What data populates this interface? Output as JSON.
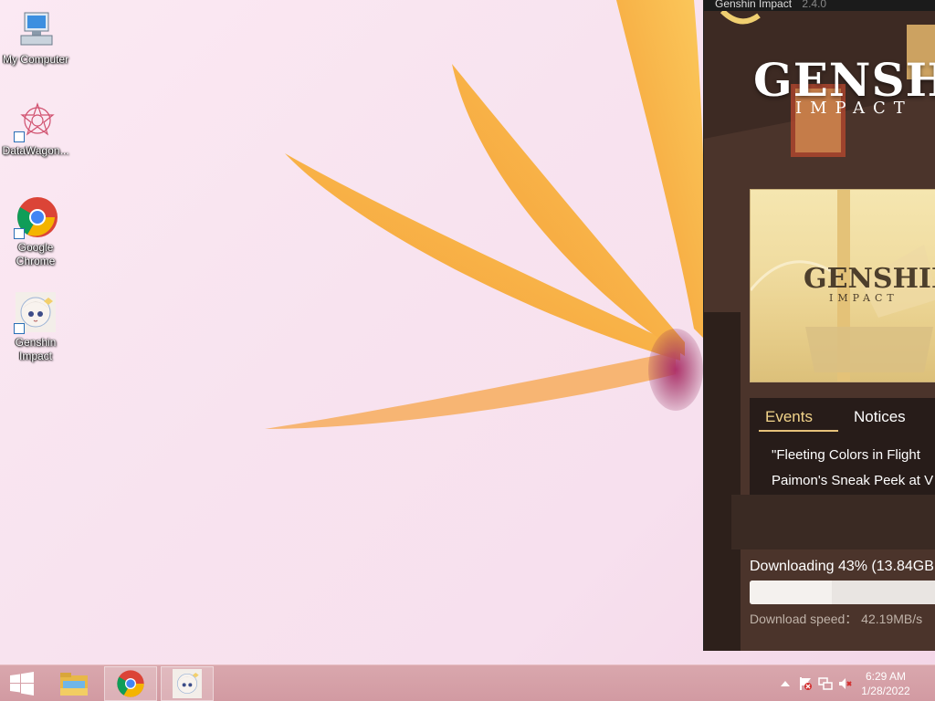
{
  "desktop": {
    "icons": [
      {
        "name": "my-computer",
        "label": "My Computer",
        "icon": "computer-icon"
      },
      {
        "name": "datawagon",
        "label": "DataWagon...",
        "icon": "datawagon-icon"
      },
      {
        "name": "google-chrome",
        "label": "Google Chrome",
        "icon": "chrome-icon"
      },
      {
        "name": "genshin-impact",
        "label": "Genshin Impact",
        "icon": "genshin-icon"
      }
    ]
  },
  "launcher": {
    "title": "Genshin Impact",
    "version": "2.4.0",
    "logo_main": "GENSHIN",
    "logo_sub": "IMPACT",
    "banner_logo_main": "GENSHIN",
    "banner_logo_sub": "IMPACT",
    "tabs": [
      {
        "label": "Events",
        "active": true
      },
      {
        "label": "Notices",
        "active": false
      }
    ],
    "news": [
      "\"Fleeting Colors in Flight",
      "Paimon's Sneak Peek at V"
    ],
    "download": {
      "status": "Downloading 43% (13.84GB",
      "progress": 0.43,
      "speed": "Download speed： 42.19MB/s"
    },
    "colors": {
      "accent": "#e6c27a",
      "panel": "#3a2b24"
    }
  },
  "taskbar": {
    "start_icon": "windows-logo-icon",
    "apps": [
      {
        "name": "file-explorer",
        "icon": "folder-icon",
        "active": false
      },
      {
        "name": "chrome",
        "icon": "chrome-icon",
        "active": true
      },
      {
        "name": "genshin-launcher",
        "icon": "genshin-icon",
        "active": true
      }
    ],
    "tray": [
      "show-hidden-icons-icon",
      "action-center-flag-icon",
      "network-icon",
      "volume-muted-icon"
    ],
    "time": "6:29 AM",
    "date": "1/28/2022"
  }
}
